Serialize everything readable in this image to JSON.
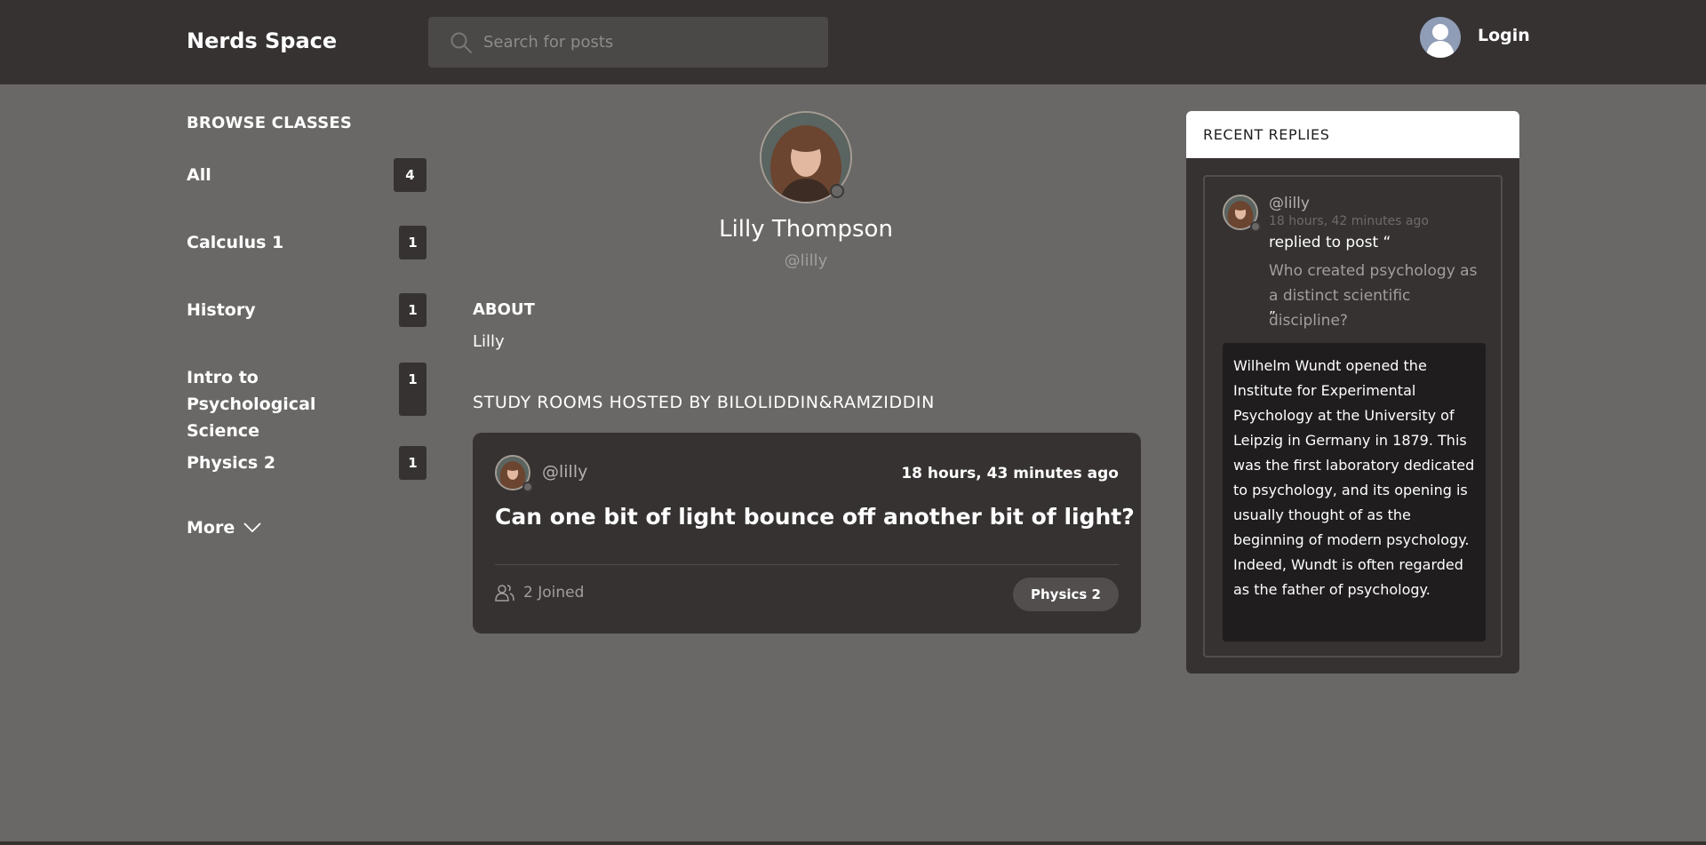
{
  "header": {
    "logo": "Nerds Space",
    "search_placeholder": "Search for posts",
    "login_label": "Login"
  },
  "sidebar": {
    "title": "BROWSE CLASSES",
    "items": [
      {
        "label": "All",
        "count": "4"
      },
      {
        "label": "Calculus 1",
        "count": "1"
      },
      {
        "label": "History",
        "count": "1"
      },
      {
        "label": "Intro to Psychological Science",
        "count": "1"
      },
      {
        "label": "Physics 2",
        "count": "1"
      }
    ],
    "more_label": "More"
  },
  "profile": {
    "name": "Lilly Thompson",
    "handle": "@lilly",
    "about_title": "ABOUT",
    "about_text": "Lilly",
    "rooms_title": "STUDY ROOMS HOSTED BY BILOLIDDIN&RAMZIDDIN"
  },
  "room": {
    "host": "@lilly",
    "time": "18 hours, 43 minutes ago",
    "title": "Can one bit of light bounce off another bit of light?",
    "joined": "2 Joined",
    "tag": "Physics 2"
  },
  "replies": {
    "title": "RECENT REPLIES",
    "user": "@lilly",
    "time": "18 hours, 42 minutes ago",
    "action": "replied to post “",
    "post": "Who created psychology as a distinct scientific discipline?",
    "quote_end": "”",
    "body": "Wilhelm Wundt opened the Institute for Experimental Psychology at the University of Leipzig in Germany in 1879. This was the first laboratory dedicated to psychology, and its opening is usually thought of as the beginning of modern psychology. Indeed, Wundt is often regarded as the father of psychology."
  },
  "colors": {
    "background": "#696866",
    "header": "#363232",
    "card": "#363232",
    "reply_body": "#1f1d1e"
  }
}
